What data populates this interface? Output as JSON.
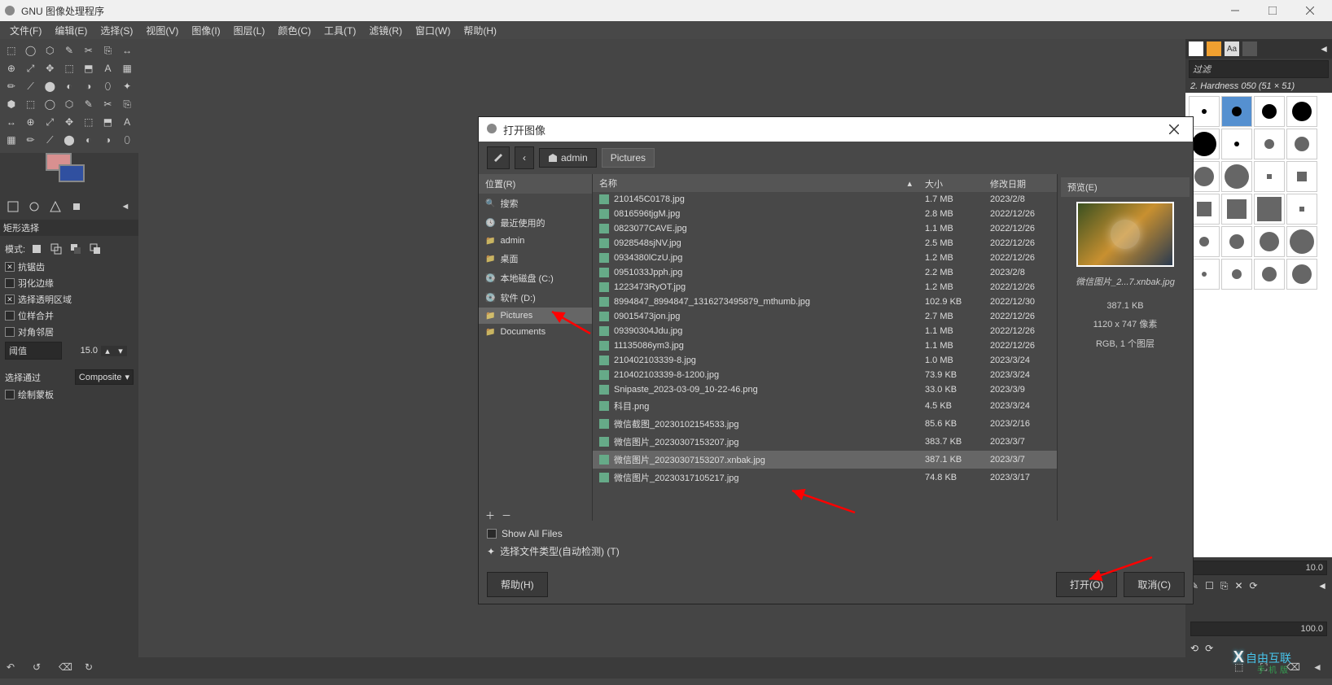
{
  "window_title": "GNU 图像处理程序",
  "menu": [
    "文件(F)",
    "编辑(E)",
    "选择(S)",
    "视图(V)",
    "图像(I)",
    "图层(L)",
    "颜色(C)",
    "工具(T)",
    "滤镜(R)",
    "窗口(W)",
    "帮助(H)"
  ],
  "tool_options": {
    "header": "矩形选择",
    "mode_label": "模式:",
    "antialias": "抗锯齿",
    "feather": "羽化边缘",
    "select_transparent": "选择透明区域",
    "sample_merged": "位样合并",
    "diagonal": "对角邻居",
    "threshold_label": "阈值",
    "threshold_value": "15.0",
    "select_by_label": "选择通过",
    "select_by_value": "Composite",
    "draw_mask": "绘制蒙板"
  },
  "brush": {
    "filter_label": "过滤",
    "selected": "2. Hardness 050 (51 × 51)",
    "spacing_value": "10.0",
    "percent_value": "100.0"
  },
  "dialog": {
    "title": "打开图像",
    "crumb1": "admin",
    "crumb2": "Pictures",
    "sidebar_header": "位置(R)",
    "sidebar": [
      {
        "label": "搜索",
        "icon": "search"
      },
      {
        "label": "最近使用的",
        "icon": "clock"
      },
      {
        "label": "admin",
        "icon": "folder"
      },
      {
        "label": "桌面",
        "icon": "folder"
      },
      {
        "label": "本地磁盘 (C:)",
        "icon": "drive"
      },
      {
        "label": "软件 (D:)",
        "icon": "drive"
      },
      {
        "label": "Pictures",
        "icon": "folder",
        "selected": true
      },
      {
        "label": "Documents",
        "icon": "folder"
      }
    ],
    "col_name": "名称",
    "col_size": "大小",
    "col_date": "修改日期",
    "files": [
      {
        "name": "210145C0178.jpg",
        "size": "1.7 MB",
        "date": "2023/2/8"
      },
      {
        "name": "0816596tjgM.jpg",
        "size": "2.8 MB",
        "date": "2022/12/26"
      },
      {
        "name": "0823077CAVE.jpg",
        "size": "1.1 MB",
        "date": "2022/12/26"
      },
      {
        "name": "0928548sjNV.jpg",
        "size": "2.5 MB",
        "date": "2022/12/26"
      },
      {
        "name": "0934380lCzU.jpg",
        "size": "1.2 MB",
        "date": "2022/12/26"
      },
      {
        "name": "0951033Jpph.jpg",
        "size": "2.2 MB",
        "date": "2023/2/8"
      },
      {
        "name": "1223473RyOT.jpg",
        "size": "1.2 MB",
        "date": "2022/12/26"
      },
      {
        "name": "8994847_8994847_1316273495879_mthumb.jpg",
        "size": "102.9 KB",
        "date": "2022/12/30"
      },
      {
        "name": "09015473jon.jpg",
        "size": "2.7 MB",
        "date": "2022/12/26"
      },
      {
        "name": "09390304Jdu.jpg",
        "size": "1.1 MB",
        "date": "2022/12/26"
      },
      {
        "name": "11135086ym3.jpg",
        "size": "1.1 MB",
        "date": "2022/12/26"
      },
      {
        "name": "210402103339-8.jpg",
        "size": "1.0 MB",
        "date": "2023/3/24"
      },
      {
        "name": "210402103339-8-1200.jpg",
        "size": "73.9 KB",
        "date": "2023/3/24"
      },
      {
        "name": "Snipaste_2023-03-09_10-22-46.png",
        "size": "33.0 KB",
        "date": "2023/3/9"
      },
      {
        "name": "科目.png",
        "size": "4.5 KB",
        "date": "2023/3/24"
      },
      {
        "name": "微信截图_20230102154533.jpg",
        "size": "85.6 KB",
        "date": "2023/2/16"
      },
      {
        "name": "微信图片_20230307153207.jpg",
        "size": "383.7 KB",
        "date": "2023/3/7"
      },
      {
        "name": "微信图片_20230307153207.xnbak.jpg",
        "size": "387.1 KB",
        "date": "2023/3/7",
        "selected": true
      },
      {
        "name": "微信图片_20230317105217.jpg",
        "size": "74.8 KB",
        "date": "2023/3/17"
      }
    ],
    "preview_header": "预览(E)",
    "preview_name": "微信图片_2...7.xnbak.jpg",
    "preview_size": "387.1 KB",
    "preview_dims": "1120 x 747 像素",
    "preview_mode": "RGB, 1 个图层",
    "show_all": "Show All Files",
    "filetype": "选择文件类型(自动检测) (T)",
    "btn_help": "帮助(H)",
    "btn_open": "打开(O)",
    "btn_cancel": "取消(C)"
  },
  "watermark": {
    "brand": "自由互联",
    "sub": "手机版"
  }
}
